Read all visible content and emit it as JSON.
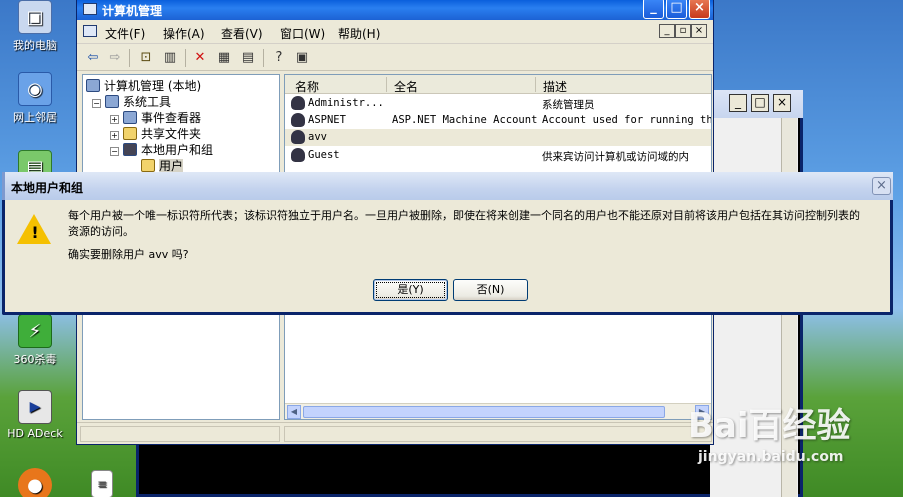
{
  "desktop": {
    "icons": [
      {
        "label": "我的电脑",
        "icon": "computer-icon"
      },
      {
        "label": "网上邻居",
        "icon": "network-icon"
      },
      {
        "label": "360杀毒",
        "icon": "shield-icon"
      },
      {
        "label": "HD ADeck",
        "icon": "audio-icon"
      }
    ]
  },
  "mmc": {
    "title": "计算机管理",
    "menu": [
      "文件(F)",
      "操作(A)",
      "查看(V)",
      "窗口(W)",
      "帮助(H)"
    ],
    "tree": {
      "root": "计算机管理 (本地)",
      "items": [
        "系统工具",
        "事件查看器",
        "共享文件夹",
        "本地用户和组",
        "用户"
      ]
    },
    "list": {
      "columns": [
        "名称",
        "全名",
        "描述"
      ],
      "rows": [
        {
          "name": "Administr...",
          "fullname": "",
          "desc": "系统管理员"
        },
        {
          "name": "ASPNET",
          "fullname": "ASP.NET Machine Account",
          "desc": "Account used for running the"
        },
        {
          "name": "avv",
          "fullname": "",
          "desc": ""
        },
        {
          "name": "Guest",
          "fullname": "",
          "desc": "供来宾访问计算机或访问域的内"
        }
      ]
    }
  },
  "dialog": {
    "title": "本地用户和组",
    "message": "每个用户被一个唯一标识符所代表；该标识符独立于用户名。一旦用户被删除，即使在将来创建一个同名的用户也不能还原对目前将该用户包括在其访问控制列表的资源的访问。",
    "confirm": "确实要删除用户 avv 吗?",
    "yes_label": "是(Y)",
    "no_label": "否(N)"
  },
  "watermark": {
    "logo": "Bai百经验",
    "url": "jingyan.baidu.com"
  }
}
